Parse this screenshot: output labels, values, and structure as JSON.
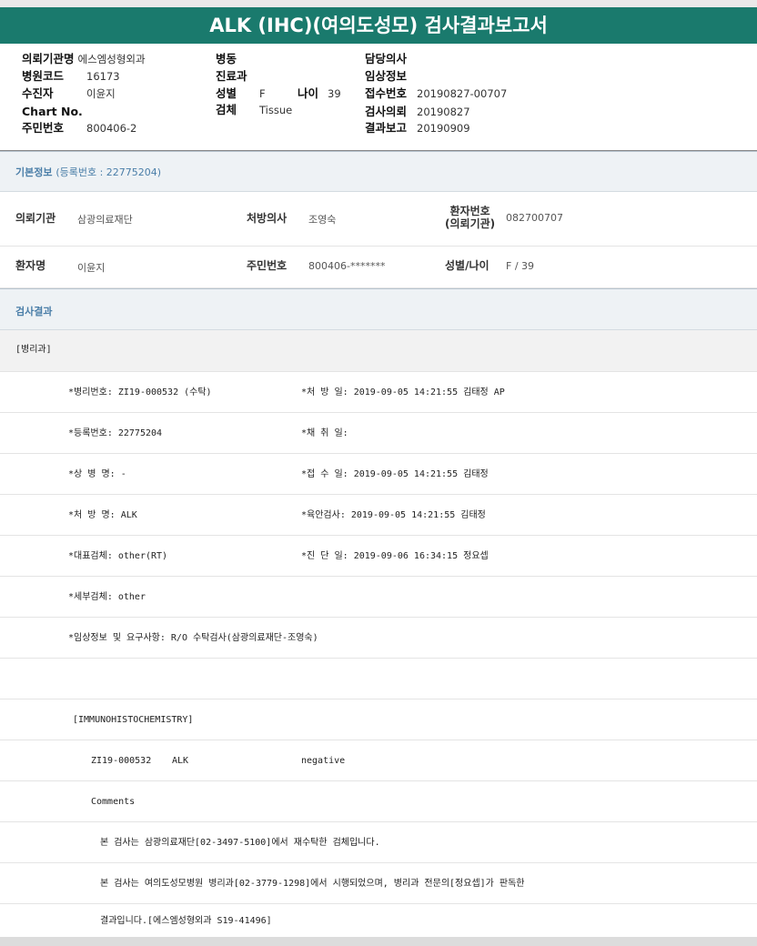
{
  "title": "ALK (IHC)(여의도성모) 검사결과보고서",
  "header": {
    "inst_label": "의뢰기관명",
    "inst_value": "에스엠성형외과",
    "code_label": "병원코드",
    "code_value": "16173",
    "recipient_label": "수진자",
    "recipient_value": "이윤지",
    "chart_label": "Chart No.",
    "chart_value": "",
    "rrn_label": "주민번호",
    "rrn_value": "800406-2",
    "ward_label": "병동",
    "ward_value": "",
    "dept_label": "진료과",
    "dept_value": "",
    "sex_label": "성별",
    "sex_value": "F",
    "age_label": "나이",
    "age_value": "39",
    "specimen_label": "검체",
    "specimen_value": "Tissue",
    "doctor_label": "담당의사",
    "doctor_value": "",
    "clinical_label": "임상정보",
    "clinical_value": "",
    "receipt_label": "접수번호",
    "receipt_value": "20190827-00707",
    "request_label": "검사의뢰",
    "request_value": "20190827",
    "report_label": "결과보고",
    "report_value": "20190909"
  },
  "basic": {
    "section_title": "기본정보",
    "reg_no": "(등록번호 : 22775204)",
    "inst_label": "의뢰기관",
    "inst_value": "삼광의료재단",
    "doctor_label": "처방의사",
    "doctor_value": "조영숙",
    "patient_no_label_1": "환자번호",
    "patient_no_label_2": "(의뢰기관)",
    "patient_no_value": "082700707",
    "patient_label": "환자명",
    "patient_value": "이윤지",
    "rrn_label": "주민번호",
    "rrn_value": "800406-*******",
    "sexage_label": "성별/나이",
    "sexage_value": "F / 39"
  },
  "result": {
    "section_title": "검사결과",
    "dept_line": "[병리과]",
    "rows": [
      {
        "left": "*병리번호: ZI19-000532 (수탁)",
        "right": "*처 방 일: 2019-09-05 14:21:55  김태정 AP"
      },
      {
        "left": "*등록번호: 22775204",
        "right": "*채 취 일:"
      },
      {
        "left": "*상 병 명: -",
        "right": "*접 수 일: 2019-09-05 14:21:55  김태정"
      },
      {
        "left": "*처 방 명: ALK",
        "right": "*육안검사: 2019-09-05 14:21:55  김태정"
      },
      {
        "left": "*대표검체: other(RT)",
        "right": "*진 단 일: 2019-09-06 16:34:15  정요셉"
      },
      {
        "left": "*세부검체: other",
        "right": ""
      },
      {
        "left": "*임상정보 및 요구사항: R/O 수탁검사(삼광의료재단-조영숙)",
        "right": ""
      }
    ],
    "ihc_title": "[IMMUNOHISTOCHEMISTRY]",
    "ihc_no": "ZI19-000532",
    "ihc_marker": "ALK",
    "ihc_result": "negative",
    "comments_label": "Comments",
    "comment_1": "본 검사는 삼광의료재단[02-3497-5100]에서 재수탁한 검체입니다.",
    "comment_2": "본 검사는 여의도성모병원 병리과[02-3779-1298]에서 시행되었으며, 병리과 전문의[정요셉]가 판독한",
    "comment_3": "결과입니다.[에스엠성형외과 S19-41496]"
  }
}
